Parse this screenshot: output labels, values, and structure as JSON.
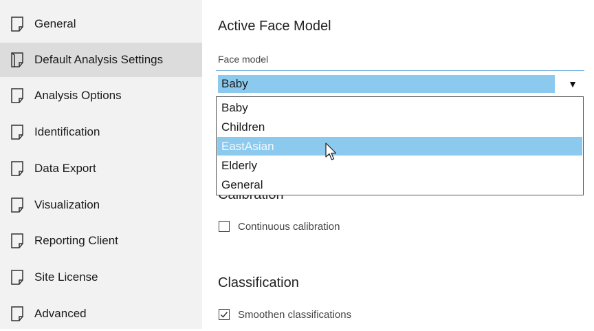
{
  "sidebar": {
    "items": [
      {
        "label": "General",
        "icon": "document-icon",
        "selected": false
      },
      {
        "label": "Default Analysis Settings",
        "icon": "open-document-icon",
        "selected": true
      },
      {
        "label": "Analysis Options",
        "icon": "document-icon",
        "selected": false
      },
      {
        "label": "Identification",
        "icon": "document-icon",
        "selected": false
      },
      {
        "label": "Data Export",
        "icon": "document-icon",
        "selected": false
      },
      {
        "label": "Visualization",
        "icon": "document-icon",
        "selected": false
      },
      {
        "label": "Reporting Client",
        "icon": "document-icon",
        "selected": false
      },
      {
        "label": "Site License",
        "icon": "document-icon",
        "selected": false
      },
      {
        "label": "Advanced",
        "icon": "document-icon",
        "selected": false
      }
    ]
  },
  "main": {
    "face_model_section": {
      "title": "Active Face Model",
      "field_label": "Face model",
      "selected_value": "Baby",
      "options": [
        "Baby",
        "Children",
        "EastAsian",
        "Elderly",
        "General"
      ],
      "hovered_option": "EastAsian"
    },
    "calibration_section": {
      "title": "Calibration",
      "checkbox_label": "Continuous calibration",
      "checked": false
    },
    "classification_section": {
      "title": "Classification",
      "checkbox_label": "Smoothen classifications",
      "checked": true
    }
  },
  "colors": {
    "sidebar_bg": "#f2f2f2",
    "sidebar_selected_bg": "#dcdcdc",
    "highlight": "#8bcaee",
    "combo_border": "#7cb4df"
  }
}
